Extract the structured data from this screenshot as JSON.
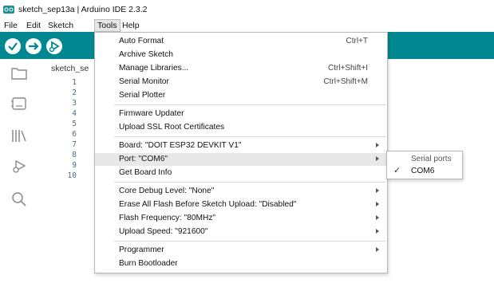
{
  "window": {
    "title": "sketch_sep13a | Arduino IDE 2.3.2"
  },
  "menubar": {
    "items": [
      "File",
      "Edit",
      "Sketch",
      "Tools",
      "Help"
    ]
  },
  "toolbar": {
    "accent": "#00878f"
  },
  "editor": {
    "tab_name": "sketch_se",
    "line_numbers": [
      "1",
      "2",
      "3",
      "4",
      "5",
      "6",
      "7",
      "8",
      "9",
      "10"
    ]
  },
  "tools_menu": {
    "auto_format": "Auto Format",
    "auto_format_sc": "Ctrl+T",
    "archive_sketch": "Archive Sketch",
    "manage_libraries": "Manage Libraries...",
    "manage_libraries_sc": "Ctrl+Shift+I",
    "serial_monitor": "Serial Monitor",
    "serial_monitor_sc": "Ctrl+Shift+M",
    "serial_plotter": "Serial Plotter",
    "firmware_updater": "Firmware Updater",
    "upload_ssl": "Upload SSL Root Certificates",
    "board": "Board: \"DOIT ESP32 DEVKIT V1\"",
    "port": "Port: \"COM6\"",
    "get_board_info": "Get Board Info",
    "core_debug": "Core Debug Level: \"None\"",
    "erase_flash": "Erase All Flash Before Sketch Upload: \"Disabled\"",
    "flash_freq": "Flash Frequency: \"80MHz\"",
    "upload_speed": "Upload Speed: \"921600\"",
    "programmer": "Programmer",
    "burn_bootloader": "Burn Bootloader"
  },
  "port_submenu": {
    "header": "Serial ports",
    "item": "COM6",
    "checkmark": "✓"
  }
}
